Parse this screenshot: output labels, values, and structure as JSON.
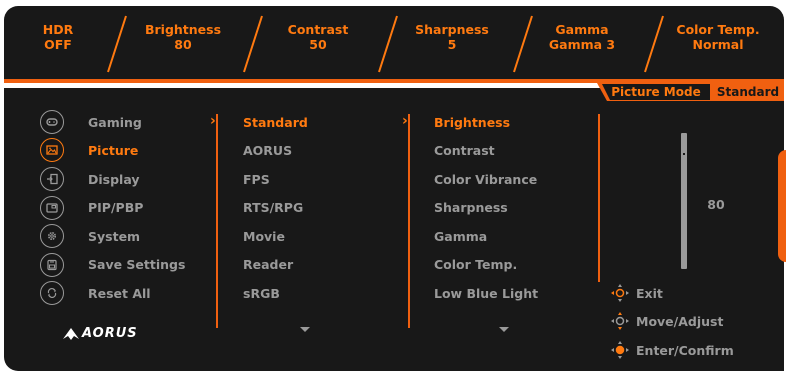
{
  "status_bar": [
    {
      "label": "HDR",
      "value": "OFF"
    },
    {
      "label": "Brightness",
      "value": "80"
    },
    {
      "label": "Contrast",
      "value": "50"
    },
    {
      "label": "Sharpness",
      "value": "5"
    },
    {
      "label": "Gamma",
      "value": "Gamma 3"
    },
    {
      "label": "Color Temp.",
      "value": "Normal"
    }
  ],
  "mode": {
    "label": "Picture Mode",
    "value": "Standard"
  },
  "main_menu": [
    {
      "label": "Gaming",
      "icon": "gamepad-icon"
    },
    {
      "label": "Picture",
      "icon": "picture-icon",
      "active": true
    },
    {
      "label": "Display",
      "icon": "display-input-icon"
    },
    {
      "label": "PIP/PBP",
      "icon": "pip-icon"
    },
    {
      "label": "System",
      "icon": "gear-icon"
    },
    {
      "label": "Save Settings",
      "icon": "save-icon"
    },
    {
      "label": "Reset All",
      "icon": "reset-icon"
    }
  ],
  "picture_modes": [
    "Standard",
    "AORUS",
    "FPS",
    "RTS/RPG",
    "Movie",
    "Reader",
    "sRGB"
  ],
  "settings": [
    "Brightness",
    "Contrast",
    "Color Vibrance",
    "Sharpness",
    "Gamma",
    "Color Temp.",
    "Low Blue Light"
  ],
  "slider": {
    "value": "80",
    "level": 0.8
  },
  "hints": {
    "exit": "Exit",
    "move": "Move/Adjust",
    "enter": "Enter/Confirm"
  },
  "brand": "AORUS",
  "colors": {
    "accent": "#f06010",
    "text_accent": "#ff7a10",
    "text_muted": "#9a9a9a",
    "background": "#181818"
  }
}
